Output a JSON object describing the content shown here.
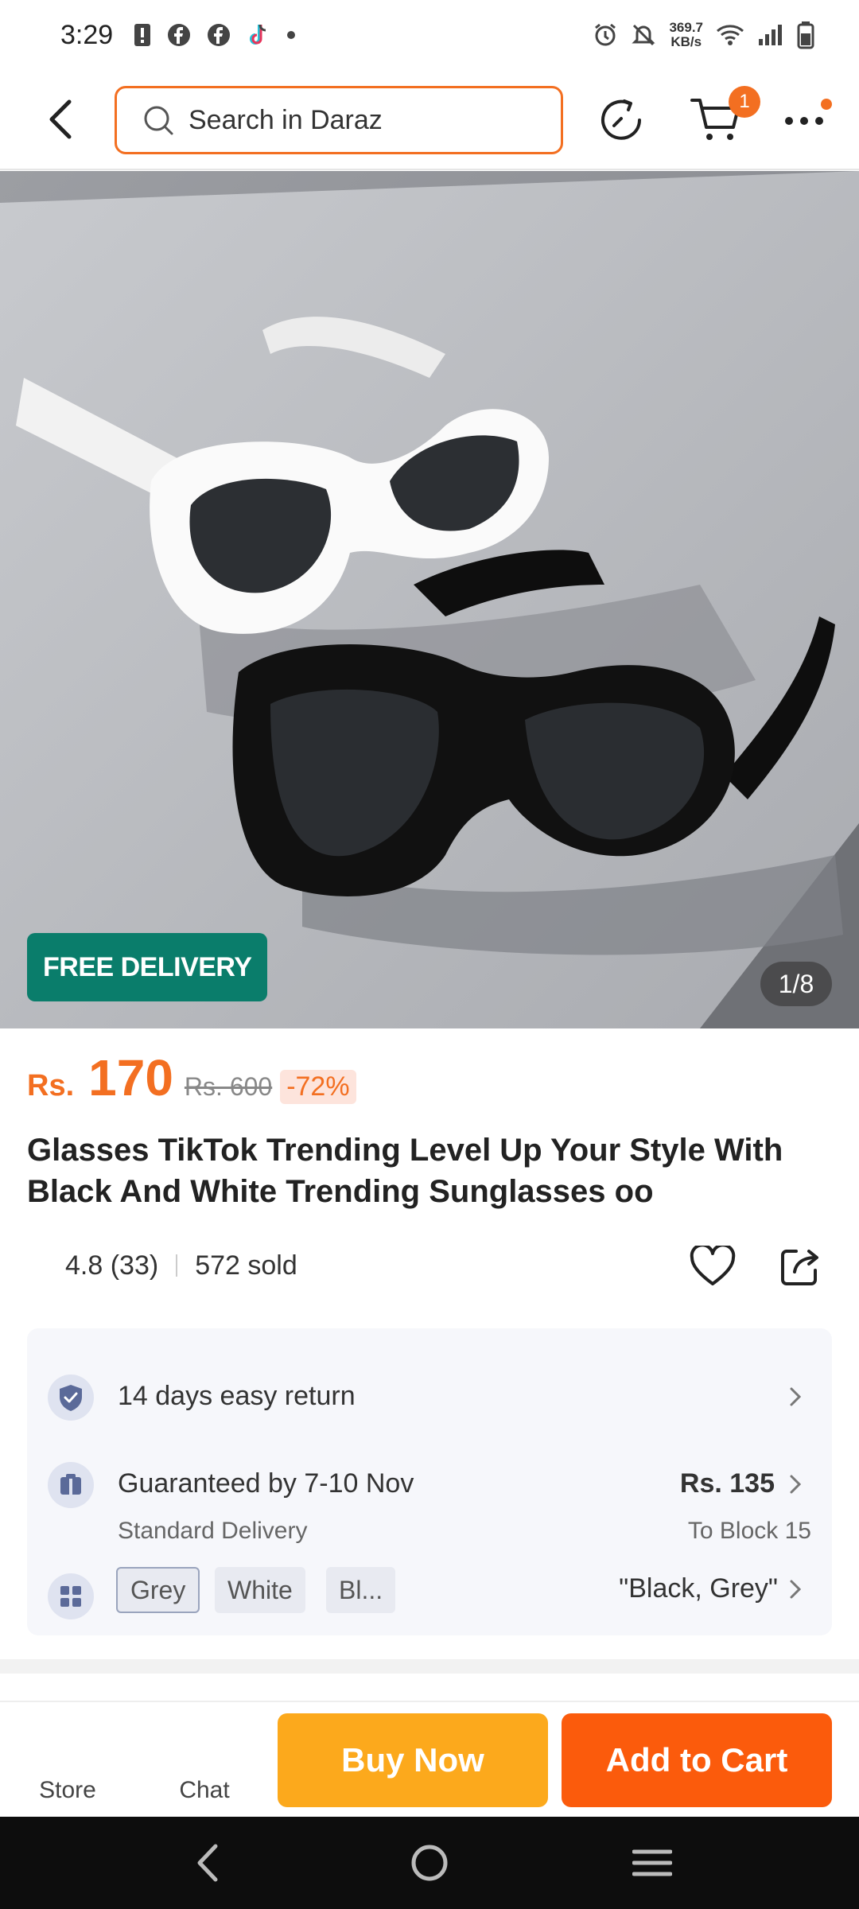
{
  "status_bar": {
    "time": "3:29",
    "net_speed_value": "369.7",
    "net_speed_unit": "KB/s"
  },
  "header": {
    "search_placeholder": "Search in Daraz",
    "cart_count": "1"
  },
  "gallery": {
    "badge": "FREE DELIVERY",
    "counter": "1/8"
  },
  "price": {
    "currency": "Rs.",
    "current": "170",
    "original": "Rs. 600",
    "discount": "-72%"
  },
  "product": {
    "title": "Glasses TikTok Trending Level Up Your Style With Black And White Trending Sunglasses oo",
    "rating": "4.8 (33)",
    "sold": "572 sold"
  },
  "info": {
    "return_text": "14 days easy return",
    "delivery_text": "Guaranteed by 7-10 Nov",
    "delivery_sub": "Standard Delivery",
    "delivery_price": "Rs. 135",
    "delivery_location": "To Block 15",
    "variants": [
      "Grey",
      "White",
      "Bl..."
    ],
    "selected_variants": "\"Black, Grey\""
  },
  "actions": {
    "store": "Store",
    "chat": "Chat",
    "buy_now": "Buy Now",
    "add_to_cart": "Add to Cart"
  },
  "colors": {
    "accent": "#f36f21",
    "buy_now": "#fca91c",
    "add_to_cart": "#fb5b0c",
    "free_delivery": "#0a7d6b"
  }
}
